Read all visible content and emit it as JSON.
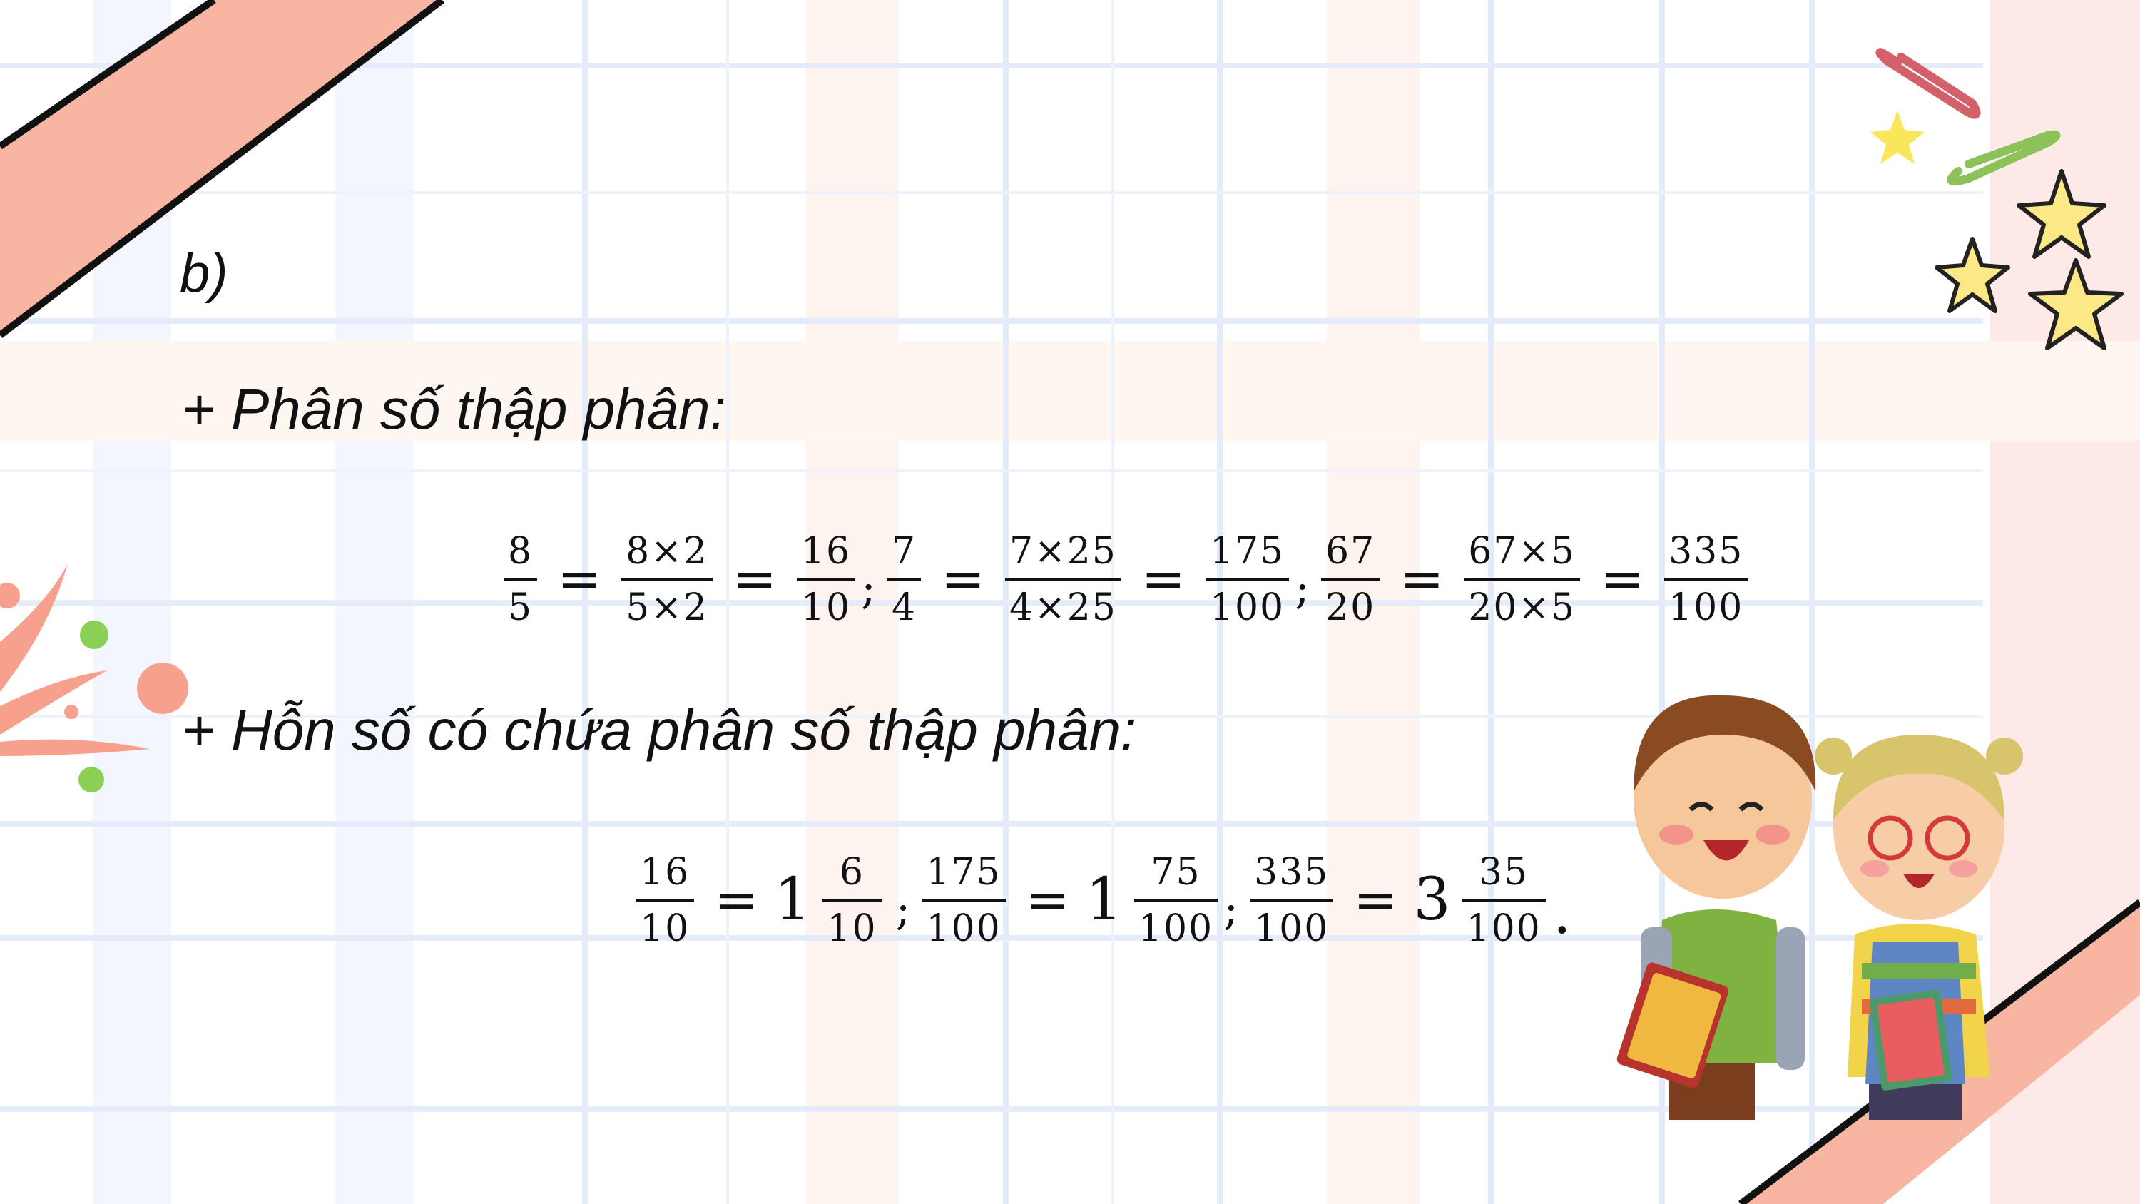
{
  "slide": {
    "part_label": "b)",
    "heading_1": "+ Phân số thập phân:",
    "heading_2": "+ Hỗn số có chứa phân số thập phân:",
    "row_1": {
      "f1": {
        "n": "8",
        "d": "5"
      },
      "f2": {
        "n": "8×2",
        "d": "5×2"
      },
      "f3": {
        "n": "16",
        "d": "10"
      },
      "sep1": ";",
      "f4": {
        "n": "7",
        "d": "4"
      },
      "f5": {
        "n": "7×25",
        "d": "4×25"
      },
      "f6": {
        "n": "175",
        "d": "100"
      },
      "sep2": ";",
      "f7": {
        "n": "67",
        "d": "20"
      },
      "f8": {
        "n": "67×5",
        "d": "20×5"
      },
      "f9": {
        "n": "335",
        "d": "100"
      },
      "eq": "="
    },
    "row_2": {
      "f1": {
        "n": "16",
        "d": "10"
      },
      "m1": {
        "whole": "1",
        "n": "6",
        "d": "10"
      },
      "sep1": ";",
      "f2": {
        "n": "175",
        "d": "100"
      },
      "m2": {
        "whole": "1",
        "n": "75",
        "d": "100"
      },
      "sep2": ";",
      "f3": {
        "n": "335",
        "d": "100"
      },
      "m3": {
        "whole": "3",
        "n": "35",
        "d": "100"
      },
      "end": ".",
      "eq": "="
    }
  },
  "colors": {
    "accent_pink": "#f7b5a2",
    "grid_blue": "#e6edfb",
    "text": "#111111"
  }
}
